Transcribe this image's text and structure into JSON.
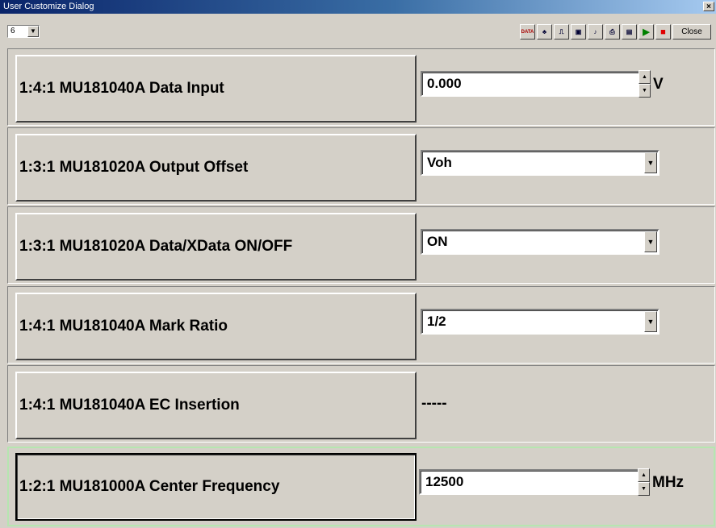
{
  "window": {
    "title": "User Customize Dialog",
    "close_glyph": "×"
  },
  "toolbar": {
    "selector_value": "6",
    "buttons": [
      {
        "name": "data-transfer-icon",
        "glyph": "DATA"
      },
      {
        "name": "pattern-icon",
        "glyph": "♣"
      },
      {
        "name": "pulse-icon",
        "glyph": "⎍"
      },
      {
        "name": "save-setup-icon",
        "glyph": "▣"
      },
      {
        "name": "sound-icon",
        "glyph": "♪"
      },
      {
        "name": "print-icon",
        "glyph": "⎙"
      },
      {
        "name": "all-icon",
        "glyph": "▤"
      },
      {
        "name": "play-icon",
        "glyph": "▶",
        "color": "#008000"
      },
      {
        "name": "stop-icon",
        "glyph": "■",
        "color": "#e00000"
      }
    ],
    "close_label": "Close"
  },
  "rows": [
    {
      "label": "1:4:1 MU181040A Data Input",
      "control": "spin",
      "value": "0.000",
      "unit": "V"
    },
    {
      "label": "1:3:1 MU181020A Output Offset",
      "control": "select",
      "value": "Voh"
    },
    {
      "label": "1:3:1 MU181020A Data/XData ON/OFF",
      "control": "select",
      "value": "ON"
    },
    {
      "label": "1:4:1 MU181040A Mark Ratio",
      "control": "select",
      "value": "1/2"
    },
    {
      "label": "1:4:1 MU181040A EC Insertion",
      "control": "none",
      "value": "-----"
    },
    {
      "label": "1:2:1 MU181000A Center Frequency",
      "control": "spin",
      "value": "12500",
      "unit": "MHz",
      "selected": true
    }
  ],
  "colors": {
    "selected_row_border": "#b6e6b0",
    "play": "#008000",
    "stop": "#e00000"
  }
}
